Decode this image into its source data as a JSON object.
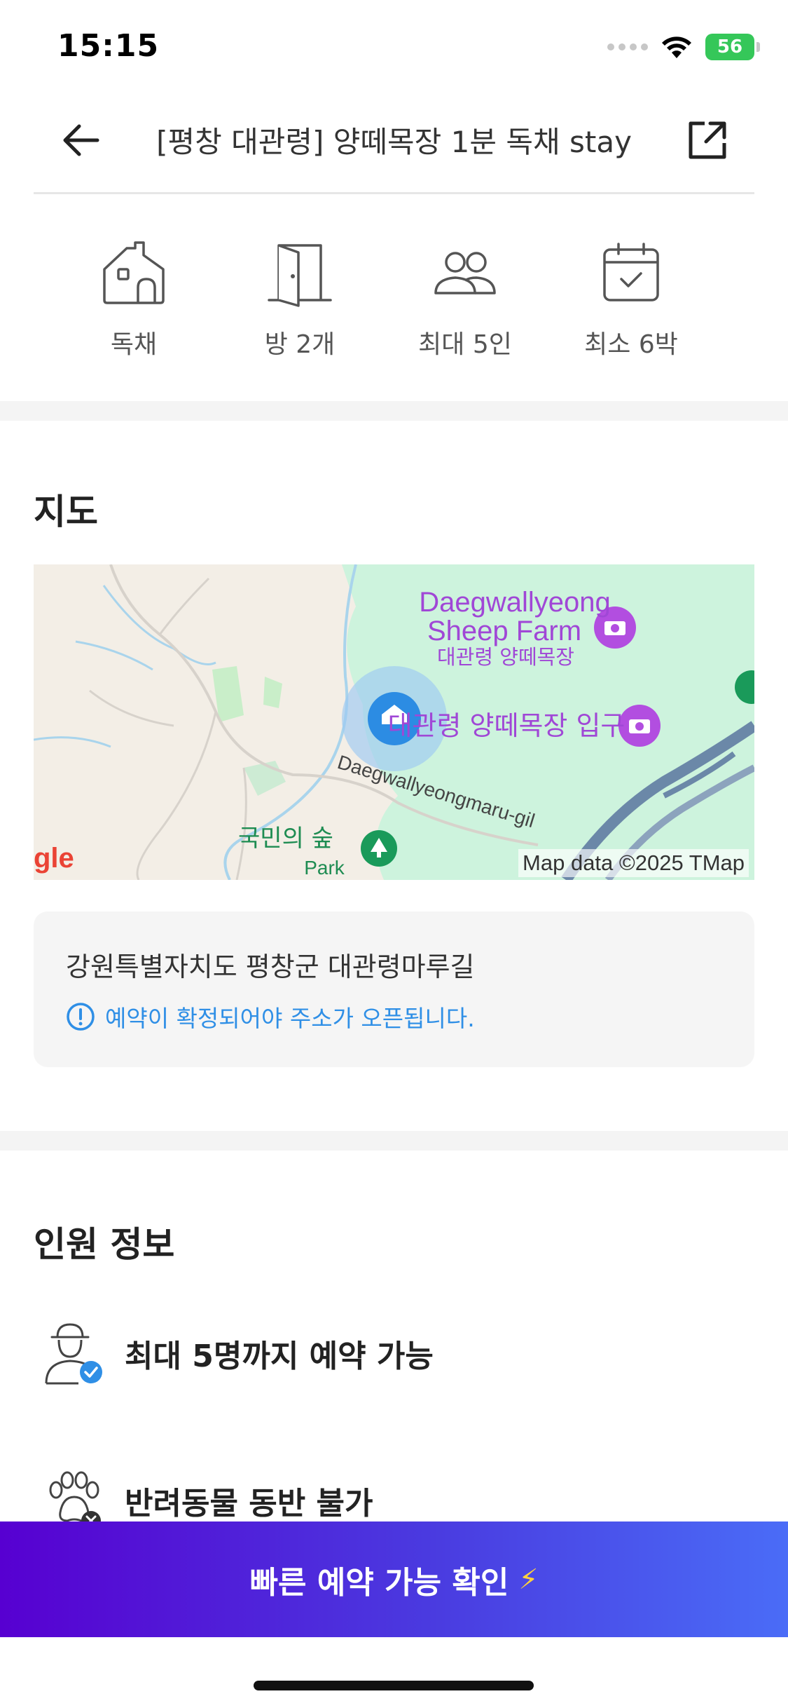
{
  "status_bar": {
    "time": "15:15",
    "battery": "56"
  },
  "header": {
    "title": "[평창 대관령] 양떼목장 1분 독채 stay"
  },
  "features": [
    {
      "icon": "house-icon",
      "label": "독채"
    },
    {
      "icon": "door-icon",
      "label": "방 2개"
    },
    {
      "icon": "people-icon",
      "label": "최대 5인"
    },
    {
      "icon": "calendar-icon",
      "label": "최소 6박"
    }
  ],
  "map_section": {
    "title": "지도",
    "map_labels": {
      "farm_en_1": "Daegwallyeong",
      "farm_en_2": "Sheep Farm",
      "farm_ko": "대관령 양떼목장",
      "entrance_ko": "대관령 양떼목장 입구",
      "road": "Daegwallyeongmaru-gil",
      "park_ko": "국민의 숲",
      "park_en": "Park",
      "google": "gle",
      "attribution": "Map data ©2025 TMap"
    },
    "address": "강원특별자치도 평창군 대관령마루길",
    "address_note": "예약이 확정되어야 주소가 오픈됩니다."
  },
  "guest_section": {
    "title": "인원 정보",
    "items": [
      {
        "icon": "person-check-icon",
        "text": "최대 5명까지 예약 가능"
      },
      {
        "icon": "paw-x-icon",
        "text": "반려동물 동반 불가"
      }
    ]
  },
  "cta": {
    "label": "빠른 예약 가능 확인",
    "bolt": "⚡"
  },
  "colors": {
    "accent_blue": "#2f8fe6",
    "cta_start": "#5700d1",
    "cta_end": "#4a6cf7",
    "map_poi": "#b24ee0"
  }
}
